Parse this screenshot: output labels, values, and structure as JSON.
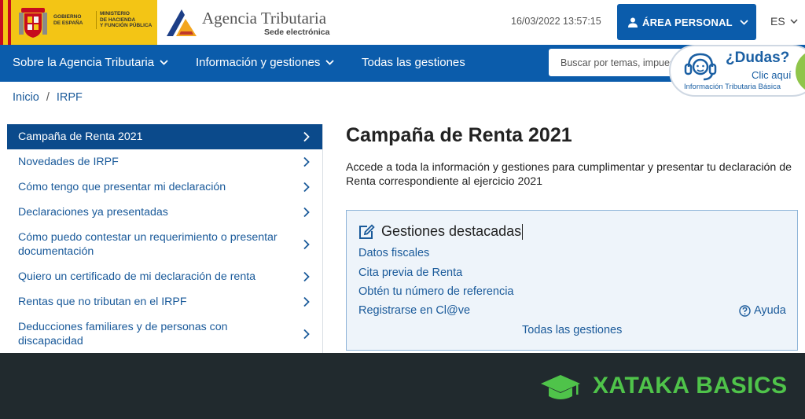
{
  "header": {
    "gov_line1": "GOBIERNO\nDE ESPAÑA",
    "gov_line2": "MINISTERIO\nDE HACIENDA\nY FUNCIÓN PÚBLICA",
    "agency_title": "Agencia Tributaria",
    "agency_subtitle": "Sede electrónica",
    "datetime": "16/03/2022 13:57:15",
    "area_personal_label": "ÁREA PERSONAL",
    "language": "ES"
  },
  "nav": {
    "items": [
      {
        "label": "Sobre la Agencia Tributaria",
        "has_dropdown": true
      },
      {
        "label": "Información y gestiones",
        "has_dropdown": true
      },
      {
        "label": "Todas las gestiones",
        "has_dropdown": false
      }
    ],
    "search_placeholder": "Buscar por temas, impuestos..."
  },
  "help_widget": {
    "title": "¿Dudas?",
    "action": "Clic aquí",
    "subtitle": "Información Tributaria Básica"
  },
  "breadcrumb": {
    "items": [
      "Inicio",
      "IRPF"
    ],
    "separator": "/"
  },
  "sidebar": {
    "items": [
      {
        "label": "Campaña de Renta 2021",
        "active": true
      },
      {
        "label": "Novedades de IRPF",
        "active": false
      },
      {
        "label": "Cómo tengo que presentar mi declaración",
        "active": false
      },
      {
        "label": "Declaraciones ya presentadas",
        "active": false
      },
      {
        "label": "Cómo puedo contestar un requerimiento o presentar documentación",
        "active": false
      },
      {
        "label": "Quiero un certificado de mi declaración de renta",
        "active": false
      },
      {
        "label": "Rentas que no tributan en el IRPF",
        "active": false
      },
      {
        "label": "Deducciones familiares y de personas con discapacidad",
        "active": false
      }
    ]
  },
  "main": {
    "title": "Campaña de Renta 2021",
    "intro": "Accede a toda la información y gestiones para cumplimentar y presentar tu declaración de Renta correspondiente al ejercicio 2021",
    "featured": {
      "heading": "Gestiones destacadas",
      "links": [
        "Datos fiscales",
        "Cita previa de Renta",
        "Obtén tu número de referencia",
        "Registrarse en Cl@ve"
      ],
      "help_label": "Ayuda",
      "all_label": "Todas las gestiones"
    }
  },
  "watermark": {
    "text": "XATAKA BASICS"
  },
  "colors": {
    "primary_blue": "#0b5cab",
    "active_blue": "#0b4a8b",
    "link_blue": "#1a5a9a",
    "gov_yellow": "#f3c515",
    "banner_dark": "#212a2e",
    "xataka_green": "#4fc34a"
  }
}
